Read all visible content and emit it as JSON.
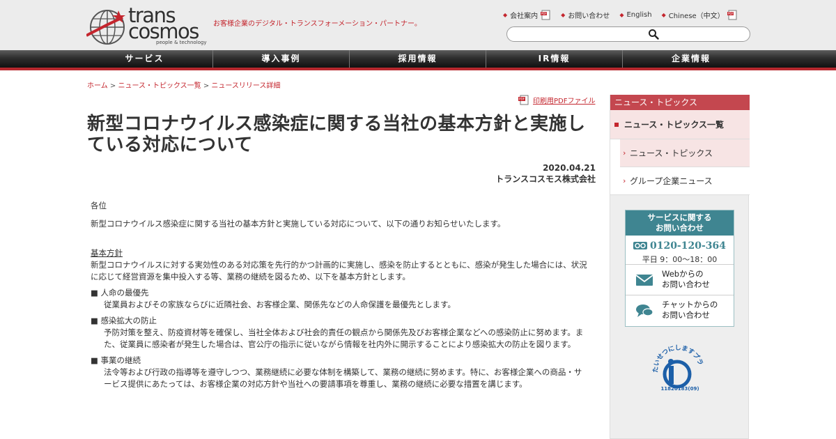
{
  "brand": {
    "logo_line1": "trans",
    "logo_line2": "cosmos",
    "logo_sub": "people & technology",
    "tagline": "お客様企業のデジタル・トランスフォーメーション・パートナー。",
    "accent_color": "#c4262e"
  },
  "util_nav": [
    {
      "label": "会社案内",
      "pdf": true
    },
    {
      "label": "お問い合わせ",
      "pdf": false
    },
    {
      "label": "English",
      "pdf": false
    },
    {
      "label": "Chinese（中文）",
      "pdf": true
    }
  ],
  "search": {
    "placeholder": "",
    "icon": "search-icon"
  },
  "global_nav": [
    "サービス",
    "導入事例",
    "採用情報",
    "IR情報",
    "企業情報"
  ],
  "breadcrumb": {
    "home": "ホーム",
    "sep": " > ",
    "list": "ニュース・トピックス一覧",
    "current": "ニュースリリース詳細"
  },
  "pdf_link": "印刷用PDFファイル",
  "article": {
    "title": "新型コロナウイルス感染症に関する当社の基本方針と実施している対応について",
    "date": "2020.04.21",
    "company": "トランスコスモス株式会社",
    "salutation": "各位",
    "intro": "新型コロナウイルス感染症に関する当社の基本方針と実施している対応について、以下の通りお知らせいたします。",
    "policy_heading": "基本方針",
    "policy_text": "新型コロナウイルスに対する実効性のある対応策を先行的かつ計画的に実施し、感染を防止するとともに、感染が発生した場合には、状況に応じて経営資源を集中投入する等、業務の継続を図るため、以下を基本方針とします。",
    "items": [
      {
        "title": "■ 人命の最優先",
        "text": "従業員およびその家族ならびに近隣社会、お客様企業、関係先などの人命保護を最優先とします。"
      },
      {
        "title": "■ 感染拡大の防止",
        "text": "予防対策を整え、防疫資材等を確保し、当社全体および社会的責任の観点から関係先及びお客様企業などへの感染防止に努めます。また、従業員に感染者が発生した場合は、官公庁の指示に従いながら情報を社内外に開示することにより感染拡大の防止を図ります。"
      },
      {
        "title": "■ 事業の継続",
        "text": "法令等および行政の指導等を遵守しつつ、業務継続に必要な体制を構築して、業務の継続に努めます。特に、お客様企業への商品・サービス提供にあたっては、お客様企業の対応方針や当社への要請事項を尊重し、業務の継続に必要な措置を講じます。"
      }
    ]
  },
  "sidebar": {
    "header": "ニュース・トピックス",
    "primary": "ニュース・トピックス一覧",
    "sub_items": [
      "ニュース・トピックス",
      "グループ企業ニュース"
    ],
    "contact": {
      "heading_line1": "サービスに関する",
      "heading_line2": "お問い合わせ",
      "phone": "0120-120-364",
      "hours": "平日 9：00～18：00",
      "web_line1": "Webからの",
      "web_line2": "お問い合わせ",
      "chat_line1": "チャットからの",
      "chat_line2": "お問い合わせ",
      "color": "#3f8591"
    },
    "privacy_mark": {
      "text": "たいせつにしますプライバシー",
      "number": "11820183(09)"
    }
  }
}
